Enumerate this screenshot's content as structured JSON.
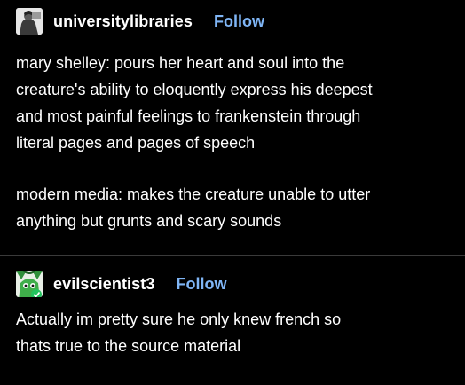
{
  "posts": [
    {
      "username": "universitylibraries",
      "follow_label": "Follow",
      "paragraphs": [
        {
          "lines": [
            "mary shelley: pours her heart and soul into the",
            "creature's ability to eloquently express his deepest",
            "and most painful feelings to frankenstein through",
            "literal pages and pages of speech"
          ]
        },
        {
          "lines": [
            "modern media: makes the creature unable to utter",
            "anything but grunts and scary sounds"
          ]
        }
      ]
    },
    {
      "username": "evilscientist3",
      "follow_label": "Follow",
      "paragraphs": [
        {
          "lines": [
            "Actually im pretty sure he only knew french so",
            "thats true to the source material"
          ]
        }
      ]
    }
  ],
  "colors": {
    "background": "#000000",
    "text": "#ffffff",
    "follow": "#7fb5f5",
    "divider": "#3a3a3a"
  },
  "icons": {
    "avatar_1": "portrait-photo-avatar",
    "avatar_2": "green-creature-avatar"
  }
}
